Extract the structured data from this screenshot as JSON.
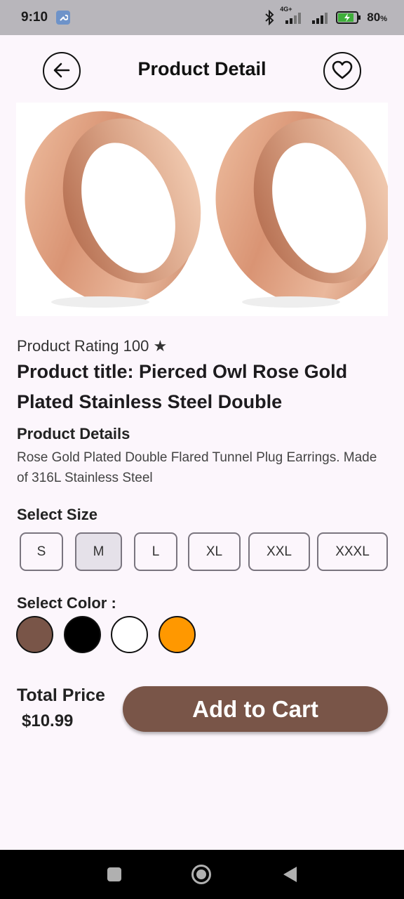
{
  "status_bar": {
    "time": "9:10",
    "network": "4G+",
    "battery_percent": "80",
    "battery_unit": "%",
    "icons": [
      "wrench-icon",
      "bluetooth-icon",
      "signal-icon",
      "signal-icon",
      "battery-charging-icon"
    ]
  },
  "app_bar": {
    "title": "Product Detail",
    "back_icon": "arrow-left-icon",
    "favorite_icon": "heart-outline-icon"
  },
  "product": {
    "rating_text": "Product Rating 100 ★",
    "title": "Product title: Pierced Owl Rose Gold Plated Stainless Steel Double",
    "details_heading": "Product Details",
    "details_text": "Rose Gold Plated Double Flared Tunnel Plug Earrings. Made of 316L Stainless Steel"
  },
  "size": {
    "heading": "Select Size",
    "options": [
      "S",
      "M",
      "L",
      "XL",
      "XXL",
      "XXXL"
    ],
    "selected": "M"
  },
  "color": {
    "heading": "Select Color :",
    "swatches": [
      "#795548",
      "#000000",
      "#ffffff",
      "#ff9800"
    ]
  },
  "footer": {
    "total_label": "Total Price",
    "total_price": "$10.99",
    "cart_label": "Add to Cart"
  },
  "colors": {
    "accent": "#795548",
    "background": "#fcf6fc"
  },
  "nav": {
    "icons": [
      "square-recents-icon",
      "circle-home-icon",
      "triangle-back-icon"
    ]
  }
}
